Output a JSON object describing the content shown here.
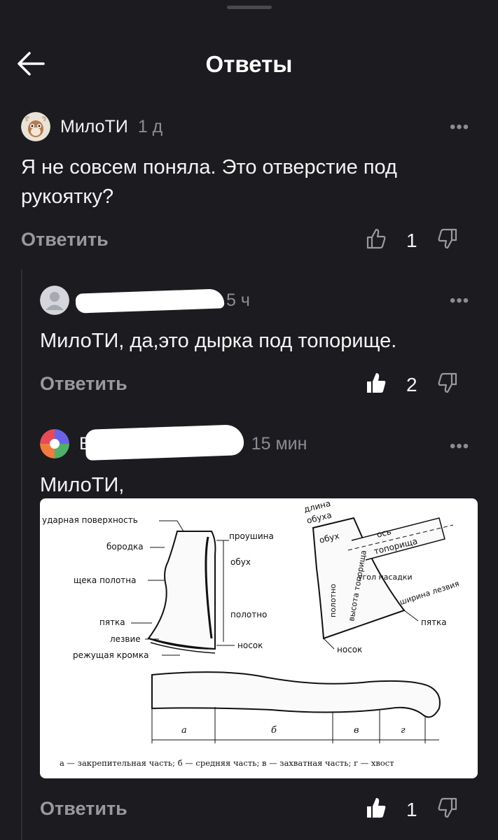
{
  "header": {
    "title": "Ответы"
  },
  "comment": {
    "author": "МилоТИ",
    "time": "1 д",
    "text": "Я не совсем поняла. Это отверстие под рукоятку?",
    "reply_label": "Ответить",
    "likes": "1"
  },
  "reply1": {
    "time": "5 ч",
    "text": "МилоТИ, да,это дырка под топорище.",
    "reply_label": "Ответить",
    "likes": "2"
  },
  "reply2": {
    "author_initial": "В",
    "time": "15 мин",
    "text": "МилоТИ,",
    "reply_label": "Ответить",
    "likes": "1",
    "figure": {
      "left_labels": {
        "strike_face": "ударная поверхность",
        "beard": "бородка",
        "cheek": "щека полотна",
        "heel": "пятка",
        "blade": "лезвие",
        "edge": "режущая кромка",
        "eye": "проушина",
        "butt": "обух",
        "body": "полотно",
        "toe": "носок"
      },
      "right_labels": {
        "length1": "длина",
        "length2": "обуха",
        "butt": "обух",
        "axis1": "ось",
        "axis2": "топорища",
        "body": "полотно",
        "height": "высота топорища",
        "angle": "угол насадки",
        "width": "ширина лезвия",
        "heel": "пятка",
        "toe": "носок"
      },
      "handle_parts": [
        "а",
        "б",
        "в",
        "г"
      ],
      "caption": "а — закрепительная часть;  б — средняя часть;  в — захватная часть;  г — хвост"
    }
  }
}
